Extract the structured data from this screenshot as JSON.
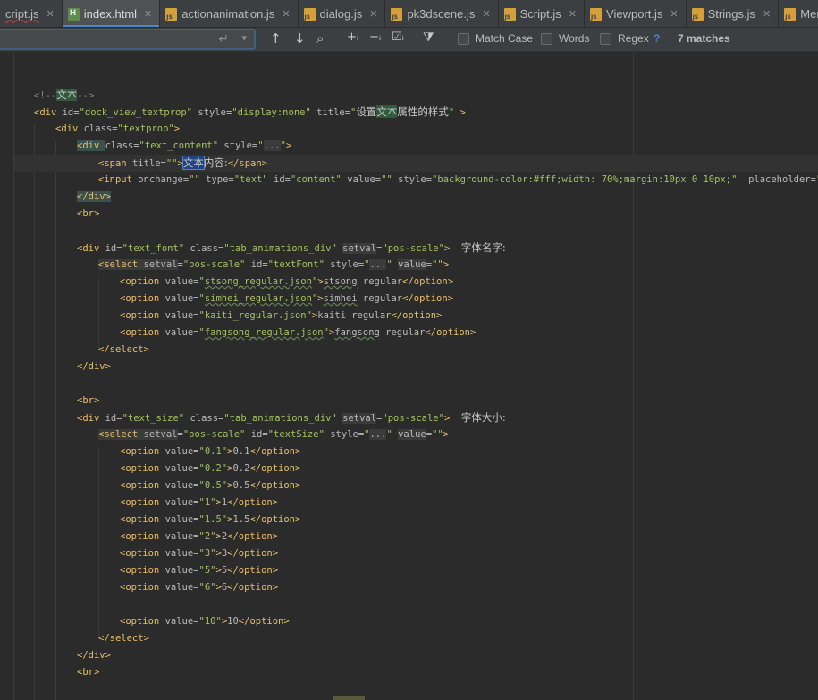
{
  "tabs": [
    {
      "label": "cript.js",
      "type": "js",
      "active": false,
      "error": true
    },
    {
      "label": "index.html",
      "type": "html",
      "active": true,
      "error": false
    },
    {
      "label": "actionanimation.js",
      "type": "js",
      "active": false,
      "error": false
    },
    {
      "label": "dialog.js",
      "type": "js",
      "active": false,
      "error": false
    },
    {
      "label": "pk3dscene.js",
      "type": "js",
      "active": false,
      "error": false
    },
    {
      "label": "Script.js",
      "type": "js",
      "active": false,
      "error": false
    },
    {
      "label": "Viewport.js",
      "type": "js",
      "active": false,
      "error": false
    },
    {
      "label": "Strings.js",
      "type": "js",
      "active": false,
      "error": false
    },
    {
      "label": "Men",
      "type": "js",
      "active": false,
      "error": false
    }
  ],
  "find": {
    "query": "",
    "match_case_label": "Match Case",
    "words_label": "Words",
    "regex_label": "Regex",
    "help_label": "?",
    "matches_text": "7 matches"
  },
  "code_lines": [
    {
      "indent": 0,
      "tokens": [
        {
          "t": "<!--",
          "c": "cmt"
        },
        {
          "t": "文本",
          "c": "zh hl-find"
        },
        {
          "t": "-->",
          "c": "cmt"
        }
      ]
    },
    {
      "indent": 0,
      "tokens": [
        {
          "t": "<div ",
          "c": "tag"
        },
        {
          "t": "id=",
          "c": "attr"
        },
        {
          "t": "\"dock_view_textprop\" ",
          "c": "val"
        },
        {
          "t": "style=",
          "c": "attr"
        },
        {
          "t": "\"display:none\" ",
          "c": "val"
        },
        {
          "t": "title=",
          "c": "attr"
        },
        {
          "t": "\"",
          "c": "val"
        },
        {
          "t": "设置",
          "c": "zh"
        },
        {
          "t": "文本",
          "c": "zh hl-find"
        },
        {
          "t": "属性的样式",
          "c": "zh"
        },
        {
          "t": "\" ",
          "c": "val"
        },
        {
          "t": ">",
          "c": "tag"
        }
      ]
    },
    {
      "indent": 1,
      "tokens": [
        {
          "t": "<div ",
          "c": "tag"
        },
        {
          "t": "class=",
          "c": "attr"
        },
        {
          "t": "\"textprop\"",
          "c": "val"
        },
        {
          "t": ">",
          "c": "tag"
        }
      ]
    },
    {
      "indent": 2,
      "tokens": [
        {
          "t": "<div ",
          "c": "tag hl-tag"
        },
        {
          "t": "class=",
          "c": "attr"
        },
        {
          "t": "\"text_content\" ",
          "c": "val"
        },
        {
          "t": "style=",
          "c": "attr"
        },
        {
          "t": "\"",
          "c": "val"
        },
        {
          "t": "...",
          "c": "attr hl-dim"
        },
        {
          "t": "\"",
          "c": "val"
        },
        {
          "t": ">",
          "c": "tag"
        }
      ]
    },
    {
      "indent": 3,
      "tokens": [
        {
          "t": "<span ",
          "c": "tag"
        },
        {
          "t": "title=",
          "c": "attr"
        },
        {
          "t": "\"\"",
          "c": "val"
        },
        {
          "t": ">",
          "c": "tag"
        },
        {
          "t": "文本",
          "c": "zh hl-sel"
        },
        {
          "t": "内容:",
          "c": "zh"
        },
        {
          "t": "</span>",
          "c": "tag"
        }
      ]
    },
    {
      "indent": 3,
      "tokens": [
        {
          "t": "<input ",
          "c": "tag"
        },
        {
          "t": "onchange=",
          "c": "attr"
        },
        {
          "t": "\"\" ",
          "c": "val"
        },
        {
          "t": "type=",
          "c": "attr"
        },
        {
          "t": "\"text\" ",
          "c": "val"
        },
        {
          "t": "id=",
          "c": "attr"
        },
        {
          "t": "\"content\" ",
          "c": "val"
        },
        {
          "t": "value=",
          "c": "attr"
        },
        {
          "t": "\"\" ",
          "c": "val"
        },
        {
          "t": "style=",
          "c": "attr"
        },
        {
          "t": "\"background-color:#fff;width: 70%;margin:10px 0 10px;\"  ",
          "c": "val"
        },
        {
          "t": "placeholder=",
          "c": "attr"
        },
        {
          "t": "\"\"",
          "c": "val"
        },
        {
          "t": "/>",
          "c": "tag"
        }
      ]
    },
    {
      "indent": 2,
      "tokens": [
        {
          "t": "</div>",
          "c": "tag hl-tag"
        }
      ]
    },
    {
      "indent": 2,
      "tokens": [
        {
          "t": "<br>",
          "c": "tag"
        }
      ]
    },
    {
      "indent": 0,
      "tokens": []
    },
    {
      "indent": 2,
      "tokens": [
        {
          "t": "<div ",
          "c": "tag"
        },
        {
          "t": "id=",
          "c": "attr"
        },
        {
          "t": "\"text_font\" ",
          "c": "val"
        },
        {
          "t": "class=",
          "c": "attr"
        },
        {
          "t": "\"tab_animations_div\" ",
          "c": "val"
        },
        {
          "t": "setval",
          "c": "attr hl-dim"
        },
        {
          "t": "=",
          "c": "attr"
        },
        {
          "t": "\"pos-scale\"",
          "c": "val"
        },
        {
          "t": ">  ",
          "c": "tag"
        },
        {
          "t": "字体名字:",
          "c": "zh"
        }
      ]
    },
    {
      "indent": 3,
      "tokens": [
        {
          "t": "<select ",
          "c": "tag hl-dim"
        },
        {
          "t": "setval",
          "c": "attr hl-dim"
        },
        {
          "t": "=",
          "c": "attr"
        },
        {
          "t": "\"pos-scale\" ",
          "c": "val"
        },
        {
          "t": "id=",
          "c": "attr"
        },
        {
          "t": "\"textFont\" ",
          "c": "val"
        },
        {
          "t": "style=",
          "c": "attr"
        },
        {
          "t": "\"",
          "c": "val"
        },
        {
          "t": "...",
          "c": "attr hl-dim"
        },
        {
          "t": "\" ",
          "c": "val"
        },
        {
          "t": "value",
          "c": "attr hl-dim"
        },
        {
          "t": "=",
          "c": "attr"
        },
        {
          "t": "\"\"",
          "c": "val"
        },
        {
          "t": ">",
          "c": "tag"
        }
      ]
    },
    {
      "indent": 4,
      "tokens": [
        {
          "t": "<option ",
          "c": "tag"
        },
        {
          "t": "value=",
          "c": "attr"
        },
        {
          "t": "\"",
          "c": "val"
        },
        {
          "t": "stsong_regular.json",
          "c": "val wavy"
        },
        {
          "t": "\"",
          "c": "val"
        },
        {
          "t": ">",
          "c": "tag"
        },
        {
          "t": "stsong",
          "c": "attr wavy"
        },
        {
          "t": " regular",
          "c": "attr"
        },
        {
          "t": "</option>",
          "c": "tag"
        }
      ]
    },
    {
      "indent": 4,
      "tokens": [
        {
          "t": "<option ",
          "c": "tag"
        },
        {
          "t": "value=",
          "c": "attr"
        },
        {
          "t": "\"",
          "c": "val"
        },
        {
          "t": "simhei_regular.json",
          "c": "val wavy"
        },
        {
          "t": "\"",
          "c": "val"
        },
        {
          "t": ">",
          "c": "tag"
        },
        {
          "t": "simhei",
          "c": "attr wavy"
        },
        {
          "t": " regular",
          "c": "attr"
        },
        {
          "t": "</option>",
          "c": "tag"
        }
      ]
    },
    {
      "indent": 4,
      "tokens": [
        {
          "t": "<option ",
          "c": "tag"
        },
        {
          "t": "value=",
          "c": "attr"
        },
        {
          "t": "\"kaiti_regular.json\"",
          "c": "val"
        },
        {
          "t": ">",
          "c": "tag"
        },
        {
          "t": "kaiti regular",
          "c": "attr"
        },
        {
          "t": "</option>",
          "c": "tag"
        }
      ]
    },
    {
      "indent": 4,
      "tokens": [
        {
          "t": "<option ",
          "c": "tag"
        },
        {
          "t": "value=",
          "c": "attr"
        },
        {
          "t": "\"",
          "c": "val"
        },
        {
          "t": "fangsong_regular.json",
          "c": "val wavy"
        },
        {
          "t": "\"",
          "c": "val"
        },
        {
          "t": ">",
          "c": "tag"
        },
        {
          "t": "fangsong",
          "c": "attr wavy"
        },
        {
          "t": " regular",
          "c": "attr"
        },
        {
          "t": "</option>",
          "c": "tag"
        }
      ]
    },
    {
      "indent": 3,
      "tokens": [
        {
          "t": "</select>",
          "c": "tag"
        }
      ]
    },
    {
      "indent": 2,
      "tokens": [
        {
          "t": "</div>",
          "c": "tag"
        }
      ]
    },
    {
      "indent": 0,
      "tokens": []
    },
    {
      "indent": 2,
      "tokens": [
        {
          "t": "<br>",
          "c": "tag"
        }
      ]
    },
    {
      "indent": 2,
      "tokens": [
        {
          "t": "<div ",
          "c": "tag"
        },
        {
          "t": "id=",
          "c": "attr"
        },
        {
          "t": "\"text_size\" ",
          "c": "val"
        },
        {
          "t": "class=",
          "c": "attr"
        },
        {
          "t": "\"tab_animations_div\" ",
          "c": "val"
        },
        {
          "t": "setval",
          "c": "attr hl-dim"
        },
        {
          "t": "=",
          "c": "attr"
        },
        {
          "t": "\"pos-scale\"",
          "c": "val"
        },
        {
          "t": ">  ",
          "c": "tag"
        },
        {
          "t": "字体大小:",
          "c": "zh"
        }
      ]
    },
    {
      "indent": 3,
      "tokens": [
        {
          "t": "<select ",
          "c": "tag hl-dim"
        },
        {
          "t": "setval",
          "c": "attr hl-dim"
        },
        {
          "t": "=",
          "c": "attr"
        },
        {
          "t": "\"pos-scale\" ",
          "c": "val"
        },
        {
          "t": "id=",
          "c": "attr"
        },
        {
          "t": "\"textSize\" ",
          "c": "val"
        },
        {
          "t": "style=",
          "c": "attr"
        },
        {
          "t": "\"",
          "c": "val"
        },
        {
          "t": "...",
          "c": "attr hl-dim"
        },
        {
          "t": "\" ",
          "c": "val"
        },
        {
          "t": "value",
          "c": "attr hl-dim"
        },
        {
          "t": "=",
          "c": "attr"
        },
        {
          "t": "\"\"",
          "c": "val"
        },
        {
          "t": ">",
          "c": "tag"
        }
      ]
    },
    {
      "indent": 4,
      "tokens": [
        {
          "t": "<option ",
          "c": "tag"
        },
        {
          "t": "value=",
          "c": "attr"
        },
        {
          "t": "\"0.1\"",
          "c": "val"
        },
        {
          "t": ">",
          "c": "tag"
        },
        {
          "t": "0.1",
          "c": "attr"
        },
        {
          "t": "</option>",
          "c": "tag"
        }
      ]
    },
    {
      "indent": 4,
      "tokens": [
        {
          "t": "<option ",
          "c": "tag"
        },
        {
          "t": "value=",
          "c": "attr"
        },
        {
          "t": "\"0.2\"",
          "c": "val"
        },
        {
          "t": ">",
          "c": "tag"
        },
        {
          "t": "0.2",
          "c": "attr"
        },
        {
          "t": "</option>",
          "c": "tag"
        }
      ]
    },
    {
      "indent": 4,
      "tokens": [
        {
          "t": "<option ",
          "c": "tag"
        },
        {
          "t": "value=",
          "c": "attr"
        },
        {
          "t": "\"0.5\"",
          "c": "val"
        },
        {
          "t": ">",
          "c": "tag"
        },
        {
          "t": "0.5",
          "c": "attr"
        },
        {
          "t": "</option>",
          "c": "tag"
        }
      ]
    },
    {
      "indent": 4,
      "tokens": [
        {
          "t": "<option ",
          "c": "tag"
        },
        {
          "t": "value=",
          "c": "attr"
        },
        {
          "t": "\"1\"",
          "c": "val"
        },
        {
          "t": ">",
          "c": "tag"
        },
        {
          "t": "1",
          "c": "attr"
        },
        {
          "t": "</option>",
          "c": "tag"
        }
      ]
    },
    {
      "indent": 4,
      "tokens": [
        {
          "t": "<option ",
          "c": "tag"
        },
        {
          "t": "value=",
          "c": "attr"
        },
        {
          "t": "\"1.5\"",
          "c": "val"
        },
        {
          "t": ">",
          "c": "tag"
        },
        {
          "t": "1.5",
          "c": "attr"
        },
        {
          "t": "</option>",
          "c": "tag"
        }
      ]
    },
    {
      "indent": 4,
      "tokens": [
        {
          "t": "<option ",
          "c": "tag"
        },
        {
          "t": "value=",
          "c": "attr"
        },
        {
          "t": "\"2\"",
          "c": "val"
        },
        {
          "t": ">",
          "c": "tag"
        },
        {
          "t": "2",
          "c": "attr"
        },
        {
          "t": "</option>",
          "c": "tag"
        }
      ]
    },
    {
      "indent": 4,
      "tokens": [
        {
          "t": "<option ",
          "c": "tag"
        },
        {
          "t": "value=",
          "c": "attr"
        },
        {
          "t": "\"3\"",
          "c": "val"
        },
        {
          "t": ">",
          "c": "tag"
        },
        {
          "t": "3",
          "c": "attr"
        },
        {
          "t": "</option>",
          "c": "tag"
        }
      ]
    },
    {
      "indent": 4,
      "tokens": [
        {
          "t": "<option ",
          "c": "tag"
        },
        {
          "t": "value=",
          "c": "attr"
        },
        {
          "t": "\"5\"",
          "c": "val"
        },
        {
          "t": ">",
          "c": "tag"
        },
        {
          "t": "5",
          "c": "attr"
        },
        {
          "t": "</option>",
          "c": "tag"
        }
      ]
    },
    {
      "indent": 4,
      "tokens": [
        {
          "t": "<option ",
          "c": "tag"
        },
        {
          "t": "value=",
          "c": "attr"
        },
        {
          "t": "\"6\"",
          "c": "val"
        },
        {
          "t": ">",
          "c": "tag"
        },
        {
          "t": "6",
          "c": "attr"
        },
        {
          "t": "</option>",
          "c": "tag"
        }
      ]
    },
    {
      "indent": 0,
      "tokens": []
    },
    {
      "indent": 4,
      "tokens": [
        {
          "t": "<option ",
          "c": "tag"
        },
        {
          "t": "value=",
          "c": "attr"
        },
        {
          "t": "\"10\"",
          "c": "val"
        },
        {
          "t": ">",
          "c": "tag"
        },
        {
          "t": "10",
          "c": "attr"
        },
        {
          "t": "</option>",
          "c": "tag"
        }
      ]
    },
    {
      "indent": 3,
      "tokens": [
        {
          "t": "</select>",
          "c": "tag"
        }
      ]
    },
    {
      "indent": 2,
      "tokens": [
        {
          "t": "</div>",
          "c": "tag"
        }
      ]
    },
    {
      "indent": 2,
      "tokens": [
        {
          "t": "<br>",
          "c": "tag"
        }
      ]
    }
  ],
  "colors": {
    "background": "#2b2b2b",
    "panel": "#3c3f41",
    "tag": "#e8bf6a",
    "attribute": "#bababa",
    "value": "#a5c261",
    "comment": "#808080",
    "find_highlight": "#32593d",
    "selection": "#214283",
    "accent": "#4a88c7"
  }
}
